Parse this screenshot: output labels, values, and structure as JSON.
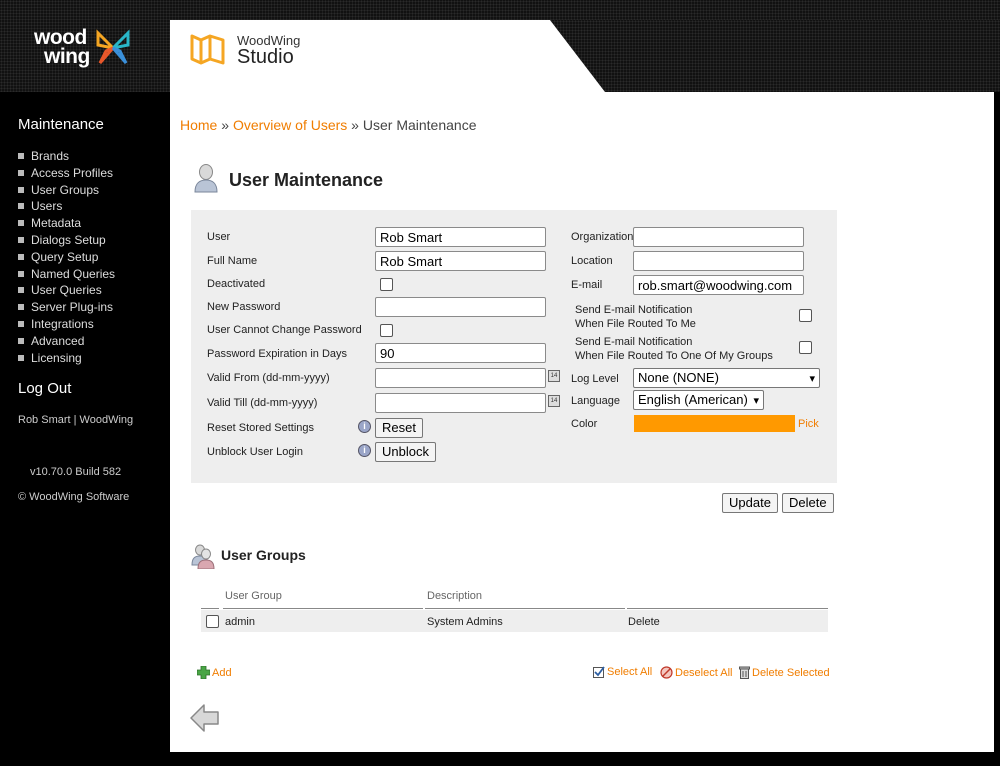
{
  "brand": {
    "logo_line1": "wood",
    "logo_line2": "wing",
    "app_small": "WoodWing",
    "app_large": "Studio"
  },
  "sidebar": {
    "title": "Maintenance",
    "items": [
      "Brands",
      "Access Profiles",
      "User Groups",
      "Users",
      "Metadata",
      "Dialogs Setup",
      "Query Setup",
      "Named Queries",
      "User Queries",
      "Server Plug-ins",
      "Integrations",
      "Advanced",
      "Licensing"
    ],
    "logout": "Log Out",
    "user": "Rob Smart | WoodWing",
    "version": "v10.70.0 Build 582",
    "copyright": "© WoodWing Software"
  },
  "breadcrumb": {
    "home": "Home",
    "sep1": " » ",
    "overview": "Overview of Users",
    "sep2": " » ",
    "current": "User Maintenance"
  },
  "page_title": "User Maintenance",
  "form": {
    "user_label": "User",
    "user_value": "Rob Smart",
    "fullname_label": "Full Name",
    "fullname_value": "Rob Smart",
    "deactivated_label": "Deactivated",
    "newpass_label": "New Password",
    "newpass_value": "",
    "cannotchange_label": "User Cannot Change Password",
    "expiration_label": "Password Expiration in Days",
    "expiration_value": "90",
    "validfrom_label": "Valid From (dd-mm-yyyy)",
    "validfrom_value": "",
    "validtill_label": "Valid Till (dd-mm-yyyy)",
    "validtill_value": "",
    "reset_label": "Reset Stored Settings",
    "reset_button": "Reset",
    "unblock_label": "Unblock User Login",
    "unblock_button": "Unblock",
    "organization_label": "Organization",
    "organization_value": "",
    "location_label": "Location",
    "location_value": "",
    "email_label": "E-mail",
    "email_value": "rob.smart@woodwing.com",
    "notify1_line1": "Send E-mail Notification",
    "notify1_line2": "When File Routed To Me",
    "notify2_line1": "Send E-mail Notification",
    "notify2_line2": "When File Routed To One Of My Groups",
    "loglevel_label": "Log Level",
    "loglevel_value": "None (NONE)",
    "language_label": "Language",
    "language_value": "English (American)",
    "color_label": "Color",
    "color_value": "#ff9900",
    "pick_label": "Pick",
    "calendar_icon_text": "14",
    "info_icon_text": "i"
  },
  "actions": {
    "update": "Update",
    "delete": "Delete"
  },
  "groups": {
    "title": "User Groups",
    "columns": [
      "User Group",
      "Description"
    ],
    "rows": [
      {
        "group": "admin",
        "description": "System Admins",
        "action": "Delete"
      }
    ],
    "add": "Add",
    "select_all": "Select All",
    "deselect_all": "Deselect All",
    "delete_selected": "Delete Selected"
  },
  "colors": {
    "accent": "#f07d00",
    "panel": "#eeeeee",
    "swatch": "#ff9900"
  }
}
